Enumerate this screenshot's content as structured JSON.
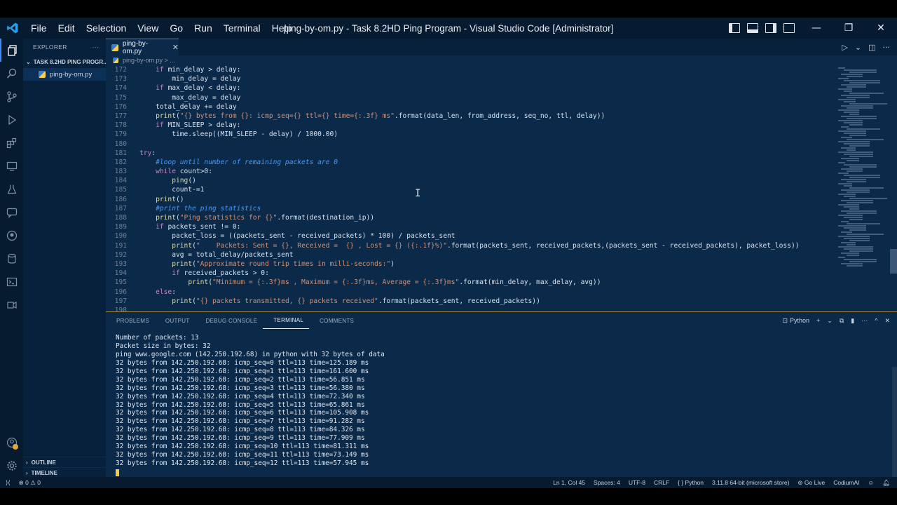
{
  "window": {
    "title": "ping-by-om.py - Task 8.2HD Ping Program - Visual Studio Code [Administrator]",
    "menu": [
      "File",
      "Edit",
      "Selection",
      "View",
      "Go",
      "Run",
      "Terminal",
      "Help"
    ],
    "controls": {
      "minimize": "—",
      "restore": "❐",
      "close": "✕"
    }
  },
  "activity_bar": {
    "icons": [
      "files-icon",
      "search-icon",
      "source-control-icon",
      "run-debug-icon",
      "extensions-icon",
      "remote-explorer-icon",
      "testing-icon",
      "chat-icon",
      "github-icon",
      "database-icon",
      "terminal-icon",
      "preview-icon"
    ],
    "bottom_icons": [
      "accounts-icon",
      "settings-gear-icon"
    ]
  },
  "sidebar": {
    "header": "EXPLORER",
    "more": "···",
    "folder": "TASK 8.2HD PING PROGR...",
    "files": [
      "ping-by-om.py"
    ],
    "sections": [
      "OUTLINE",
      "TIMELINE"
    ]
  },
  "editor": {
    "tab_label": "ping-by-om.py",
    "breadcrumb": "ping-by-om.py > ...",
    "lines": [
      {
        "n": "172",
        "text": "    if min_delay > delay:"
      },
      {
        "n": "173",
        "text": "        min_delay = delay"
      },
      {
        "n": "174",
        "text": "    if max_delay < delay:"
      },
      {
        "n": "175",
        "text": "        max_delay = delay"
      },
      {
        "n": "176",
        "text": "    total_delay += delay"
      },
      {
        "n": "177",
        "text": "    print(\"{} bytes from {}: icmp_seq={} ttl={} time={:.3f} ms\".format(data_len, from_address, seq_no, ttl, delay))"
      },
      {
        "n": "178",
        "text": "    if MIN_SLEEP > delay:"
      },
      {
        "n": "179",
        "text": "        time.sleep((MIN_SLEEP - delay) / 1000.00)"
      },
      {
        "n": "180",
        "text": ""
      },
      {
        "n": "181",
        "text": "try:"
      },
      {
        "n": "182",
        "text": "    #loop until number of remaining packets are 0"
      },
      {
        "n": "183",
        "text": "    while count>0:"
      },
      {
        "n": "184",
        "text": "        ping()"
      },
      {
        "n": "185",
        "text": "        count-=1"
      },
      {
        "n": "186",
        "text": "    print()"
      },
      {
        "n": "187",
        "text": "    #print the ping statistics"
      },
      {
        "n": "188",
        "text": "    print(\"Ping statistics for {}\".format(destination_ip))"
      },
      {
        "n": "189",
        "text": "    if packets_sent != 0:"
      },
      {
        "n": "190",
        "text": "        packet_loss = ((packets_sent - received_packets) * 100) / packets_sent"
      },
      {
        "n": "191",
        "text": "        print(\"    Packets: Sent = {}, Received =  {} , Lost = {} ({:.1f}%)\".format(packets_sent, received_packets,(packets_sent - received_packets), packet_loss))"
      },
      {
        "n": "192",
        "text": "        avg = total_delay/packets_sent"
      },
      {
        "n": "193",
        "text": "        print(\"Approximate round trip times in milli-seconds:\")"
      },
      {
        "n": "194",
        "text": "        if received_packets > 0:"
      },
      {
        "n": "195",
        "text": "            print(\"Minimum = {:.3f}ms , Maximum = {:.3f}ms, Average = {:.3f}ms\".format(min_delay, max_delay, avg))"
      },
      {
        "n": "196",
        "text": "    else:"
      },
      {
        "n": "197",
        "text": "        print(\"{} packets transmitted, {} packets received\".format(packets_sent, received_packets))"
      },
      {
        "n": "198",
        "text": ""
      }
    ]
  },
  "panel": {
    "tabs": [
      "PROBLEMS",
      "OUTPUT",
      "DEBUG CONSOLE",
      "TERMINAL",
      "COMMENTS"
    ],
    "active_tab": "TERMINAL",
    "shell_label": "Python",
    "actions": {
      "add": "+",
      "dropdown": "⌄",
      "split": "⧉",
      "trash": "🗑",
      "more": "···",
      "maximize": "^",
      "close": "✕"
    },
    "terminal_lines": [
      "Number of packets: 13",
      "Packet size in bytes: 32",
      "ping www.google.com (142.250.192.68) in python with 32 bytes of data",
      "32 bytes from 142.250.192.68: icmp_seq=0 ttl=113 time=125.189 ms",
      "32 bytes from 142.250.192.68: icmp_seq=1 ttl=113 time=161.600 ms",
      "32 bytes from 142.250.192.68: icmp_seq=2 ttl=113 time=56.851 ms",
      "32 bytes from 142.250.192.68: icmp_seq=3 ttl=113 time=56.380 ms",
      "32 bytes from 142.250.192.68: icmp_seq=4 ttl=113 time=72.340 ms",
      "32 bytes from 142.250.192.68: icmp_seq=5 ttl=113 time=65.861 ms",
      "32 bytes from 142.250.192.68: icmp_seq=6 ttl=113 time=105.908 ms",
      "32 bytes from 142.250.192.68: icmp_seq=7 ttl=113 time=91.282 ms",
      "32 bytes from 142.250.192.68: icmp_seq=8 ttl=113 time=84.326 ms",
      "32 bytes from 142.250.192.68: icmp_seq=9 ttl=113 time=77.909 ms",
      "32 bytes from 142.250.192.68: icmp_seq=10 ttl=113 time=81.311 ms",
      "32 bytes from 142.250.192.68: icmp_seq=11 ttl=113 time=73.149 ms",
      "32 bytes from 142.250.192.68: icmp_seq=12 ttl=113 time=57.945 ms"
    ]
  },
  "statusbar": {
    "problems": "⊗ 0 ⚠ 0",
    "position": "Ln 1, Col 45",
    "spaces": "Spaces: 4",
    "encoding": "UTF-8",
    "eol": "CRLF",
    "language": "Python",
    "interpreter": "3.11.8 64-bit (microsoft store)",
    "golive": "Go Live",
    "codium": "CodiumAI"
  },
  "colors": {
    "accent": "#3a8cff",
    "background": "#0b2a4a",
    "chrome": "#061a30"
  }
}
